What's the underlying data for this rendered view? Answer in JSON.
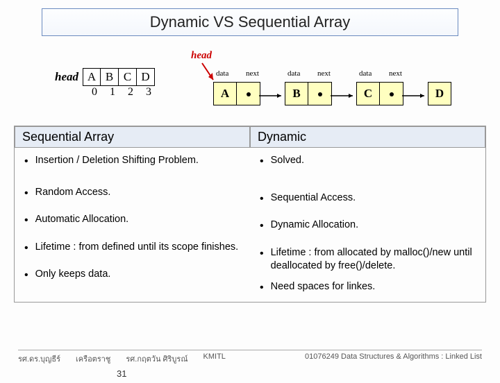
{
  "title": "Dynamic  VS  Sequential Array",
  "seq_diagram": {
    "head_label": "head",
    "cells": [
      "A",
      "B",
      "C",
      "D"
    ],
    "indices": [
      "0",
      "1",
      "2",
      "3"
    ]
  },
  "linked_diagram": {
    "head_label": "head",
    "field_data": "data",
    "field_next": "next",
    "nodes": [
      "A",
      "B",
      "C",
      "D"
    ]
  },
  "table": {
    "left_header": "Sequential Array",
    "right_header": "Dynamic",
    "left": [
      "Insertion / Deletion Shifting Problem.",
      "Random Access.",
      "Automatic Allocation.",
      "Lifetime : from defined until its scope finishes.",
      "Only keeps data."
    ],
    "right": [
      "Solved.",
      "Sequential Access.",
      "Dynamic Allocation.",
      "Lifetime : from allocated by malloc()/new until deallocated by free()/delete.",
      "Need spaces for linkes."
    ]
  },
  "footer": {
    "author1": "รศ.ดร.บุญธีร์",
    "author2": "เครือตราชู",
    "author3": "รศ.กฤตวัน  ศิริบูรณ์",
    "org": "KMITL",
    "course": "01076249 Data Structures & Algorithms  : Linked List",
    "page": "31"
  }
}
